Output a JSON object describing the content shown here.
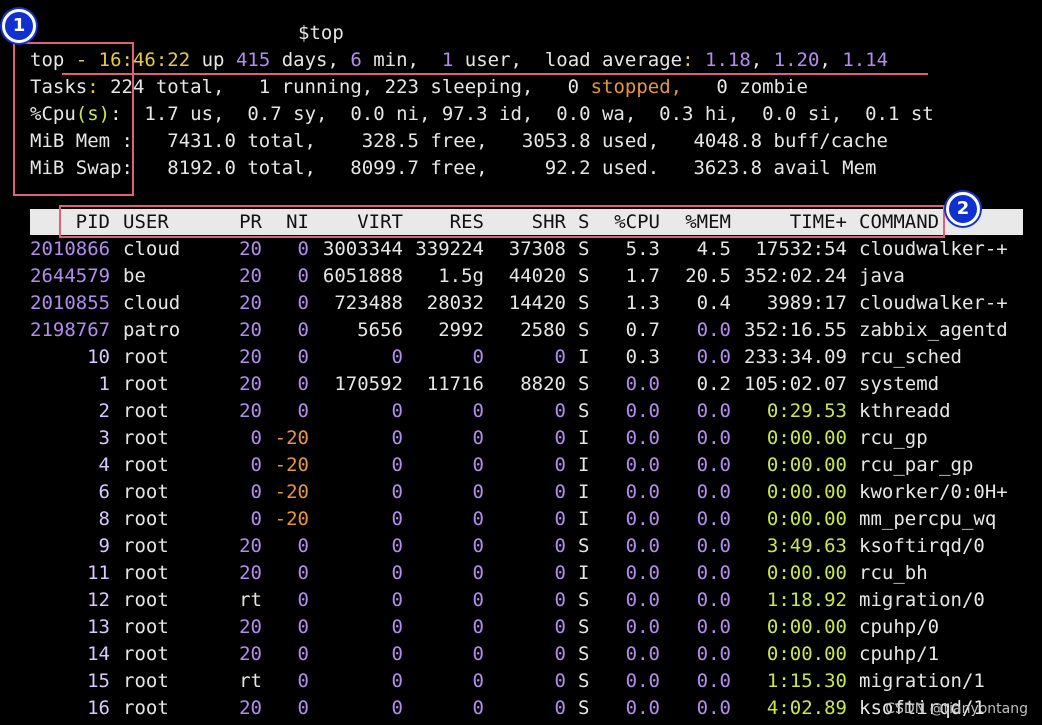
{
  "prompt": "$top",
  "summary": {
    "line1": {
      "prefix": "top",
      "dash_time": " - 16:46:22",
      "up": " up ",
      "days_num": "415",
      "days_label": " days, ",
      "min_num": "6",
      "min_label": " min,  ",
      "users_num": "1",
      "users_label": " user,  load average",
      "colon": ": ",
      "load1": "1.18",
      "comma1": ", ",
      "load5": "1.20",
      "comma2": ", ",
      "load15": "1.14"
    },
    "line2": {
      "label": "Tasks",
      "c": ": ",
      "total": "224 total,",
      "running": "   1 running,",
      "sleeping": " 223 sleeping,",
      "stopped_num": "   0 ",
      "stopped_label": "stopped,",
      "zombie": "   0 zombie"
    },
    "line3": {
      "label": "%Cpu",
      "paren": "(s)",
      "colon": ":",
      "rest": "  1.7 us,  0.7 sy,  0.0 ni, 97.3 id,  0.0 wa,  0.3 hi,  0.0 si,  0.1 st"
    },
    "line4": "MiB Mem :   7431.0 total,    328.5 free,   3053.8 used,   4048.8 buff/cache",
    "line5": "MiB Swap:   8192.0 total,   8099.7 free,     92.2 used.   3623.8 avail Mem"
  },
  "table": {
    "headers": [
      "PID",
      "USER",
      "PR",
      "NI",
      "VIRT",
      "RES",
      "SHR",
      "S",
      "%CPU",
      "%MEM",
      "TIME+",
      "COMMAND"
    ],
    "rows": [
      [
        "2010866",
        "cloud",
        "20",
        "0",
        "3003344",
        "339224",
        "37308",
        "S",
        "5.3",
        "4.5",
        "17532:54",
        "cloudwalker-+"
      ],
      [
        "2644579",
        "be",
        "20",
        "0",
        "6051888",
        "1.5g",
        "44020",
        "S",
        "1.7",
        "20.5",
        "352:02.24",
        "java"
      ],
      [
        "2010855",
        "cloud",
        "20",
        "0",
        "723488",
        "28032",
        "14420",
        "S",
        "1.3",
        "0.4",
        "3989:17",
        "cloudwalker-+"
      ],
      [
        "2198767",
        "patro",
        "20",
        "0",
        "5656",
        "2992",
        "2580",
        "S",
        "0.7",
        "0.0",
        "352:16.55",
        "zabbix_agentd"
      ],
      [
        "10",
        "root",
        "20",
        "0",
        "0",
        "0",
        "0",
        "I",
        "0.3",
        "0.0",
        "233:34.09",
        "rcu_sched"
      ],
      [
        "1",
        "root",
        "20",
        "0",
        "170592",
        "11716",
        "8820",
        "S",
        "0.0",
        "0.2",
        "105:02.07",
        "systemd"
      ],
      [
        "2",
        "root",
        "20",
        "0",
        "0",
        "0",
        "0",
        "S",
        "0.0",
        "0.0",
        "0:29.53",
        "kthreadd"
      ],
      [
        "3",
        "root",
        "0",
        "-20",
        "0",
        "0",
        "0",
        "I",
        "0.0",
        "0.0",
        "0:00.00",
        "rcu_gp"
      ],
      [
        "4",
        "root",
        "0",
        "-20",
        "0",
        "0",
        "0",
        "I",
        "0.0",
        "0.0",
        "0:00.00",
        "rcu_par_gp"
      ],
      [
        "6",
        "root",
        "0",
        "-20",
        "0",
        "0",
        "0",
        "I",
        "0.0",
        "0.0",
        "0:00.00",
        "kworker/0:0H+"
      ],
      [
        "8",
        "root",
        "0",
        "-20",
        "0",
        "0",
        "0",
        "I",
        "0.0",
        "0.0",
        "0:00.00",
        "mm_percpu_wq"
      ],
      [
        "9",
        "root",
        "20",
        "0",
        "0",
        "0",
        "0",
        "S",
        "0.0",
        "0.0",
        "3:49.63",
        "ksoftirqd/0"
      ],
      [
        "11",
        "root",
        "20",
        "0",
        "0",
        "0",
        "0",
        "I",
        "0.0",
        "0.0",
        "0:00.00",
        "rcu_bh"
      ],
      [
        "12",
        "root",
        "rt",
        "0",
        "0",
        "0",
        "0",
        "S",
        "0.0",
        "0.0",
        "1:18.92",
        "migration/0"
      ],
      [
        "13",
        "root",
        "20",
        "0",
        "0",
        "0",
        "0",
        "S",
        "0.0",
        "0.0",
        "0:00.00",
        "cpuhp/0"
      ],
      [
        "14",
        "root",
        "20",
        "0",
        "0",
        "0",
        "0",
        "S",
        "0.0",
        "0.0",
        "0:00.00",
        "cpuhp/1"
      ],
      [
        "15",
        "root",
        "rt",
        "0",
        "0",
        "0",
        "0",
        "S",
        "0.0",
        "0.0",
        "1:15.30",
        "migration/1"
      ],
      [
        "16",
        "root",
        "20",
        "0",
        "0",
        "0",
        "0",
        "S",
        "0.0",
        "0.0",
        "4:02.89",
        "ksoftirqd/1"
      ]
    ]
  },
  "annotations": {
    "badge1": "1",
    "badge2": "2"
  },
  "watermark": "CSDN @tianyontang",
  "colors": {
    "background": "#000000",
    "annotation_box": "#e0607a",
    "badge": "#1030d0",
    "number_highlight": "#b38cf0",
    "stopped": "#e8963a",
    "negative_ni": "#e8963a",
    "time_zero": "#c8e84a"
  }
}
